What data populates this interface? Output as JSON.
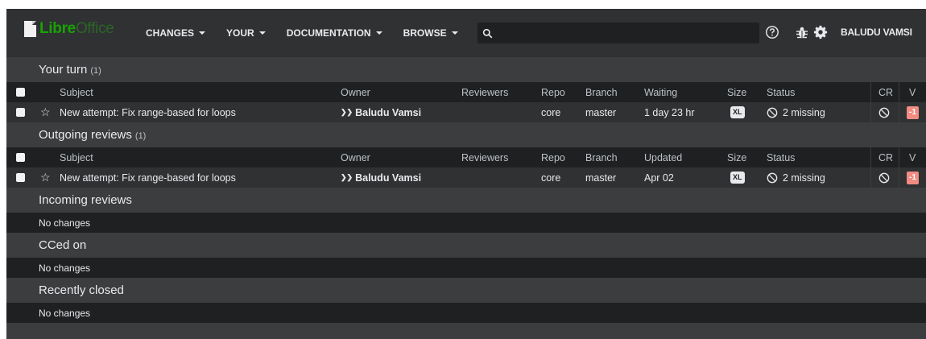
{
  "header": {
    "logo_libre": "Libre",
    "logo_office": "Office",
    "nav": [
      {
        "label": "CHANGES"
      },
      {
        "label": "YOUR"
      },
      {
        "label": "DOCUMENTATION"
      },
      {
        "label": "BROWSE"
      }
    ],
    "search": {
      "value": "",
      "placeholder": ""
    },
    "user_name": "BALUDU VAMSI"
  },
  "columns_your_turn": {
    "subject": "Subject",
    "owner": "Owner",
    "reviewers": "Reviewers",
    "repo": "Repo",
    "branch": "Branch",
    "waiting": "Waiting",
    "size": "Size",
    "status": "Status",
    "cr": "CR",
    "v": "V"
  },
  "columns_outgoing": {
    "subject": "Subject",
    "owner": "Owner",
    "reviewers": "Reviewers",
    "repo": "Repo",
    "branch": "Branch",
    "updated": "Updated",
    "size": "Size",
    "status": "Status",
    "cr": "CR",
    "v": "V"
  },
  "sections": {
    "your_turn": {
      "title": "Your turn",
      "count": "(1)",
      "row": {
        "subject": "New attempt: Fix range-based for loops",
        "owner": "Baludu Vamsi",
        "reviewers": "",
        "repo": "core",
        "branch": "master",
        "time": "1 day 23 hr",
        "size": "XL",
        "status": "2 missing",
        "v": "-1"
      }
    },
    "outgoing": {
      "title": "Outgoing reviews",
      "count": "(1)",
      "row": {
        "subject": "New attempt: Fix range-based for loops",
        "owner": "Baludu Vamsi",
        "reviewers": "",
        "repo": "core",
        "branch": "master",
        "time": "Apr 02",
        "size": "XL",
        "status": "2 missing",
        "v": "-1"
      }
    },
    "incoming": {
      "title": "Incoming reviews",
      "empty": "No changes"
    },
    "cced": {
      "title": "CCed on",
      "empty": "No changes"
    },
    "recently_closed": {
      "title": "Recently closed",
      "empty": "No changes"
    }
  },
  "icons": {
    "search": "search-icon",
    "help": "help-icon",
    "bug": "bug-icon",
    "settings": "gear-icon",
    "star": "star-icon",
    "blocked": "blocked-icon"
  },
  "colors": {
    "brand_green": "#18a303",
    "header_bg": "#2f3133",
    "page_bg": "#3b3d3f",
    "table_header_bg": "#1e2022",
    "vote_negative": "#f28b82"
  }
}
